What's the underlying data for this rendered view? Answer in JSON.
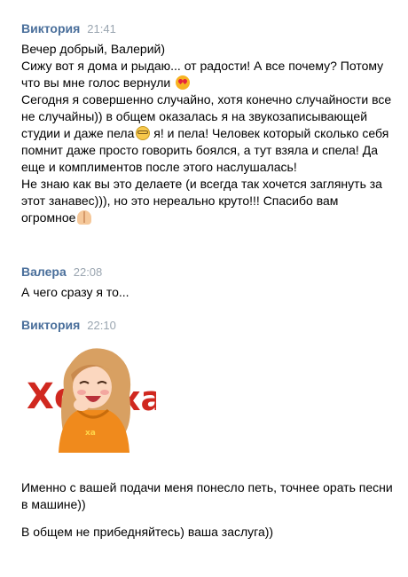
{
  "messages": [
    {
      "author": "Виктория",
      "time": "21:41",
      "lines": [
        "Вечер добрый, Валерий)",
        "Сижу вот я дома и рыдаю... от радости! А все почему? Потому что вы мне голос вернули",
        "Сегодня я совершенно случайно, хотя конечно случайности все не случайны)) в общем оказалась я на звукозаписывающей студии и даже пела",
        " я! и пела! Человек который сколько себя помнит даже просто говорить боялся, а тут взяла и спела! Да еще и комплиментов после этого наслушалась!",
        "Не знаю как вы это делаете (и всегда так хочется заглянуть за этот занавес))), но это нереально круто!!! Спасибо вам огромное"
      ],
      "emojis": [
        "heart-eyes-emoji",
        "nerd-face-emoji",
        "folded-hands-emoji"
      ]
    },
    {
      "author": "Валера",
      "time": "22:08",
      "lines": [
        "А чего сразу я то..."
      ]
    },
    {
      "author": "Виктория",
      "time": "22:10",
      "sticker": {
        "caption": "Хо-ха",
        "icon": "laughing-girl-sticker"
      },
      "lines": [
        "Именно с вашей подачи меня понесло петь, точнее орать песни в машине))",
        "В общем не прибедняйтесь) ваша заслуга))"
      ]
    }
  ],
  "colors": {
    "author": "#4a6f9b",
    "time": "#9aa5b0",
    "sticker_text": "#d0281f",
    "hoodie": "#f08a1c"
  }
}
